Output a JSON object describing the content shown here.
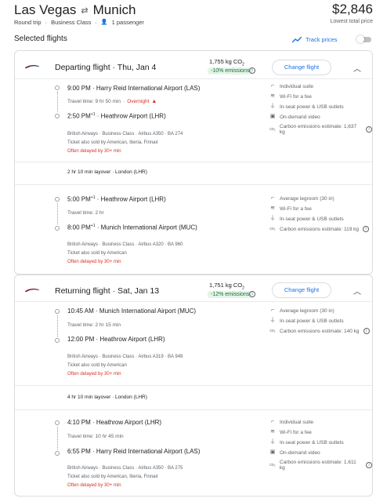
{
  "header": {
    "origin": "Las Vegas",
    "swap_icon": "swap-arrows-icon",
    "destination": "Munich",
    "trip_type": "Round trip",
    "cabin": "Business Class",
    "passengers": "1 passenger",
    "price": "$2,846",
    "price_caption": "Lowest total price"
  },
  "selected": {
    "heading": "Selected flights",
    "track_label": "Track prices"
  },
  "departing": {
    "title": "Departing flight",
    "date": "Thu, Jan 4",
    "co2": "1,755 kg CO",
    "co2_sub": "2",
    "emissions": "-10% emissions",
    "change": "Change flight",
    "seg1": {
      "dep_time": "9:00 PM",
      "dep_airport": "Harry Reid International Airport (LAS)",
      "travel": "Travel time: 9 hr 50 min",
      "overnight": "Overnight",
      "arr_time": "2:50 PM",
      "arr_sup": "+1",
      "arr_airport": "Heathrow Airport (LHR)",
      "details": "British Airways · Business Class · Airbus A350 · BA 274",
      "sold": "Ticket also sold by American, Iberia, Finnair",
      "delay": "Often delayed by 30+ min",
      "amenities": [
        "Individual suite",
        "Wi-Fi for a fee",
        "In-seat power & USB outlets",
        "On-demand video",
        "Carbon emissions estimate: 1,637 kg"
      ]
    },
    "layover": "2 hr 10 min layover · London (LHR)",
    "seg2": {
      "dep_time": "5:00 PM",
      "dep_sup": "+1",
      "dep_airport": "Heathrow Airport (LHR)",
      "travel": "Travel time: 2 hr",
      "arr_time": "8:00 PM",
      "arr_sup": "+1",
      "arr_airport": "Munich International Airport (MUC)",
      "details": "British Airways · Business Class · Airbus A320 · BA 960",
      "sold": "Ticket also sold by American",
      "delay": "Often delayed by 30+ min",
      "amenities": [
        "Average legroom (30 in)",
        "Wi-Fi for a fee",
        "In-seat power & USB outlets",
        "Carbon emissions estimate: 119 kg"
      ]
    }
  },
  "returning": {
    "title": "Returning flight",
    "date": "Sat, Jan 13",
    "co2": "1,751 kg CO",
    "co2_sub": "2",
    "emissions": "-12% emissions",
    "change": "Change flight",
    "seg1": {
      "dep_time": "10:45 AM",
      "dep_airport": "Munich International Airport (MUC)",
      "travel": "Travel time: 2 hr 15 min",
      "arr_time": "12:00 PM",
      "arr_airport": "Heathrow Airport (LHR)",
      "details": "British Airways · Business Class · Airbus A319 · BA 949",
      "sold": "Ticket also sold by American",
      "delay": "Often delayed by 30+ min",
      "amenities": [
        "Average legroom (30 in)",
        "In-seat power & USB outlets",
        "Carbon emissions estimate: 140 kg"
      ]
    },
    "layover": "4 hr 10 min layover · London (LHR)",
    "seg2": {
      "dep_time": "4:10 PM",
      "dep_airport": "Heathrow Airport (LHR)",
      "travel": "Travel time: 10 hr 45 min",
      "arr_time": "6:55 PM",
      "arr_airport": "Harry Reid International Airport (LAS)",
      "details": "British Airways · Business Class · Airbus A350 · BA 275",
      "sold": "Ticket also sold by American, Iberia, Finnair",
      "delay": "Often delayed by 30+ min",
      "amenities": [
        "Individual suite",
        "Wi-Fi for a fee",
        "In-seat power & USB outlets",
        "On-demand video",
        "Carbon emissions estimate: 1,611 kg"
      ]
    }
  },
  "colors": {
    "accent": "#1a73e8",
    "warning": "#d93025",
    "green": "#137333"
  }
}
